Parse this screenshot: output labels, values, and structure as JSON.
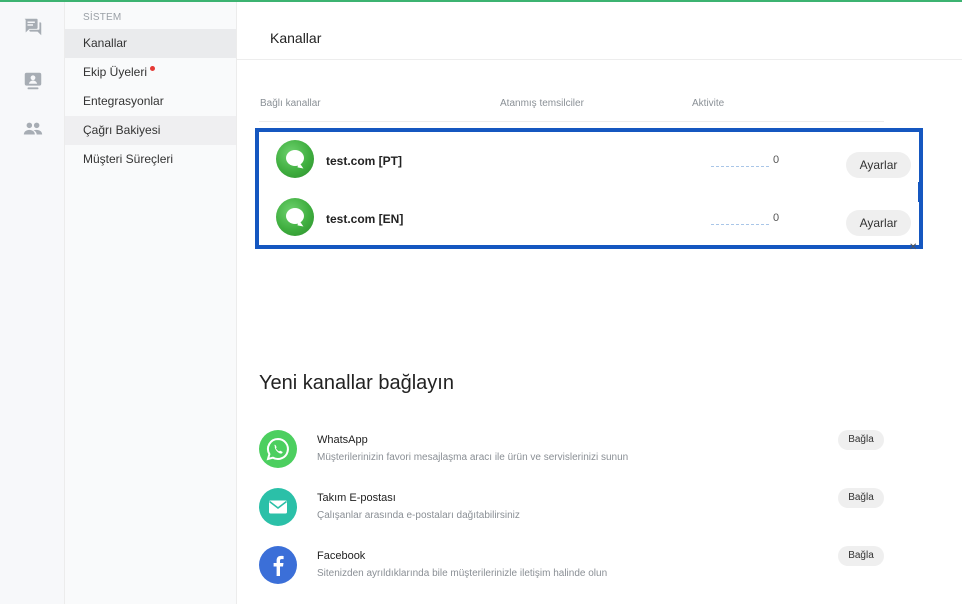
{
  "sidebar": {
    "section": "SİSTEM",
    "items": [
      {
        "label": "Kanallar"
      },
      {
        "label": "Ekip Üyeleri"
      },
      {
        "label": "Entegrasyonlar"
      },
      {
        "label": "Çağrı Bakiyesi"
      },
      {
        "label": "Müşteri Süreçleri"
      }
    ]
  },
  "rail": {
    "icons": [
      "chat-icon",
      "contact-card-icon",
      "team-icon"
    ]
  },
  "main": {
    "title": "Kanallar",
    "columns": {
      "connected": "Bağlı kanallar",
      "assigned": "Atanmış temsilciler",
      "activity": "Aktivite"
    },
    "channels": [
      {
        "name": "test.com [PT]",
        "count": "0",
        "button": "Ayarlar"
      },
      {
        "name": "test.com [EN]",
        "count": "0",
        "button": "Ayarlar"
      }
    ],
    "new_section_title": "Yeni kanallar bağlayın",
    "connectors": [
      {
        "name": "WhatsApp",
        "desc": "Müşterilerinizin favori mesajlaşma aracı ile ürün ve servislerinizi sunun",
        "button": "Bağla",
        "icon": "whatsapp-icon",
        "color": "#4ccf5f"
      },
      {
        "name": "Takım E-postası",
        "desc": "Çalışanlar arasında e-postaları dağıtabilirsiniz",
        "button": "Bağla",
        "icon": "email-icon",
        "color": "#2bc0a8"
      },
      {
        "name": "Facebook",
        "desc": "Sitenizden ayrıldıklarında bile müşterilerinizle iletişim halinde olun",
        "button": "Bağla",
        "icon": "facebook-icon",
        "color": "#3b6fd8"
      }
    ]
  },
  "colors": {
    "accent_green": "#3cb371",
    "selection_blue": "#1557c0"
  }
}
